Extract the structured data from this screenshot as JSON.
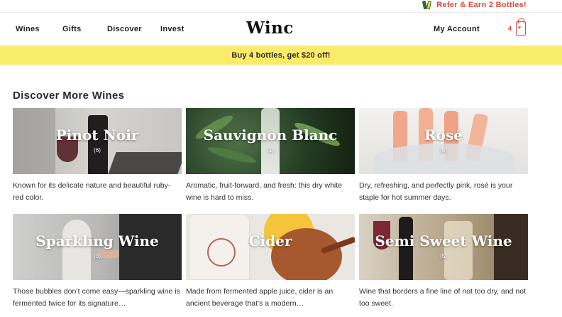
{
  "promo_strip": {
    "text": "Refer & Earn 2 Bottles!",
    "icon": "wine-bottles-icon"
  },
  "nav": {
    "items": [
      "Wines",
      "Gifts",
      "Discover",
      "Invest"
    ],
    "logo": "Winc",
    "account": "My Account",
    "cart_count": "4"
  },
  "banner": {
    "text": "Buy 4 bottles, get $20 off!"
  },
  "section": {
    "title": "Discover More Wines",
    "cards": [
      {
        "name": "Pinot Noir",
        "count": "(6)",
        "desc": "Known for its delicate nature and beautiful ruby-red color."
      },
      {
        "name": "Sauvignon Blanc",
        "count": "(1)",
        "desc": "Aromatic, fruit-forward, and fresh: this dry white wine is hard to miss."
      },
      {
        "name": "Rosé",
        "count": "(5)",
        "desc": "Dry, refreshing, and perfectly pink, rosé is your staple for hot summer days."
      },
      {
        "name": "Sparkling Wine",
        "count": "(3)",
        "desc": "Those bubbles don’t come easy—sparkling wine is fermented twice for its signature…"
      },
      {
        "name": "Cider",
        "count": "",
        "desc": "Made from fermented apple juice, cider is an ancient beverage that’s a modern…"
      },
      {
        "name": "Semi Sweet Wine",
        "count": "(5)",
        "desc": "Wine that borders a fine line of not too dry, and not too sweet."
      }
    ]
  },
  "colors": {
    "accent": "#e0483b",
    "banner": "#f9ec6a"
  }
}
